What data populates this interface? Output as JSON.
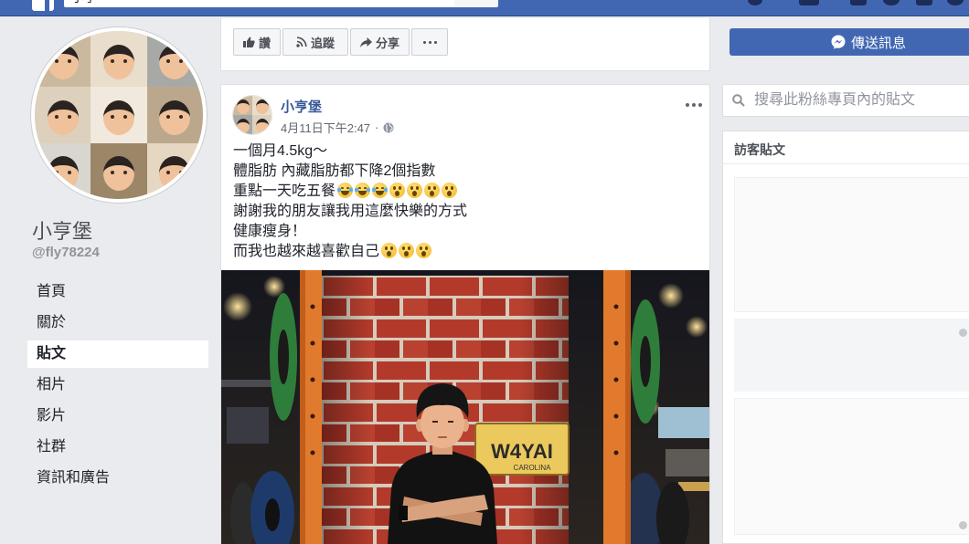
{
  "topbar": {
    "search_value": "小亨"
  },
  "profile": {
    "name": "小亨堡",
    "username": "@fly78224"
  },
  "nav": [
    {
      "label": "首頁"
    },
    {
      "label": "關於"
    },
    {
      "label": "貼文",
      "active": true
    },
    {
      "label": "相片"
    },
    {
      "label": "影片"
    },
    {
      "label": "社群"
    },
    {
      "label": "資訊和廣告"
    }
  ],
  "page_actions": {
    "like_label": "讚",
    "follow_label": "追蹤",
    "share_label": "分享"
  },
  "post": {
    "author": "小亨堡",
    "time": "4月11日下午2:47",
    "separator": "·",
    "lines": [
      {
        "text": "一個月4.5kg～",
        "emoji": []
      },
      {
        "text": "體脂肪 內藏脂肪都下降2個指數",
        "emoji": []
      },
      {
        "text": "重點一天吃五餐",
        "emoji": [
          "joy",
          "joy",
          "joy",
          "astonished",
          "astonished",
          "astonished",
          "astonished"
        ]
      },
      {
        "text": "謝謝我的朋友讓我用這麼快樂的方式",
        "emoji": []
      },
      {
        "text": "健康瘦身！",
        "emoji": []
      },
      {
        "text": "而我也越來越喜歡自己",
        "emoji": [
          "astonished",
          "astonished",
          "astonished"
        ]
      }
    ]
  },
  "photo": {
    "plate_number": "W4YAI",
    "plate_state": "CAROLINA"
  },
  "sidebar": {
    "message_label": "傳送訊息",
    "search_placeholder": "搜尋此粉絲專頁內的貼文",
    "visitor_posts_title": "訪客貼文"
  },
  "colors": {
    "brand": "#4267b2",
    "link": "#365899",
    "background": "#e9ebee"
  }
}
